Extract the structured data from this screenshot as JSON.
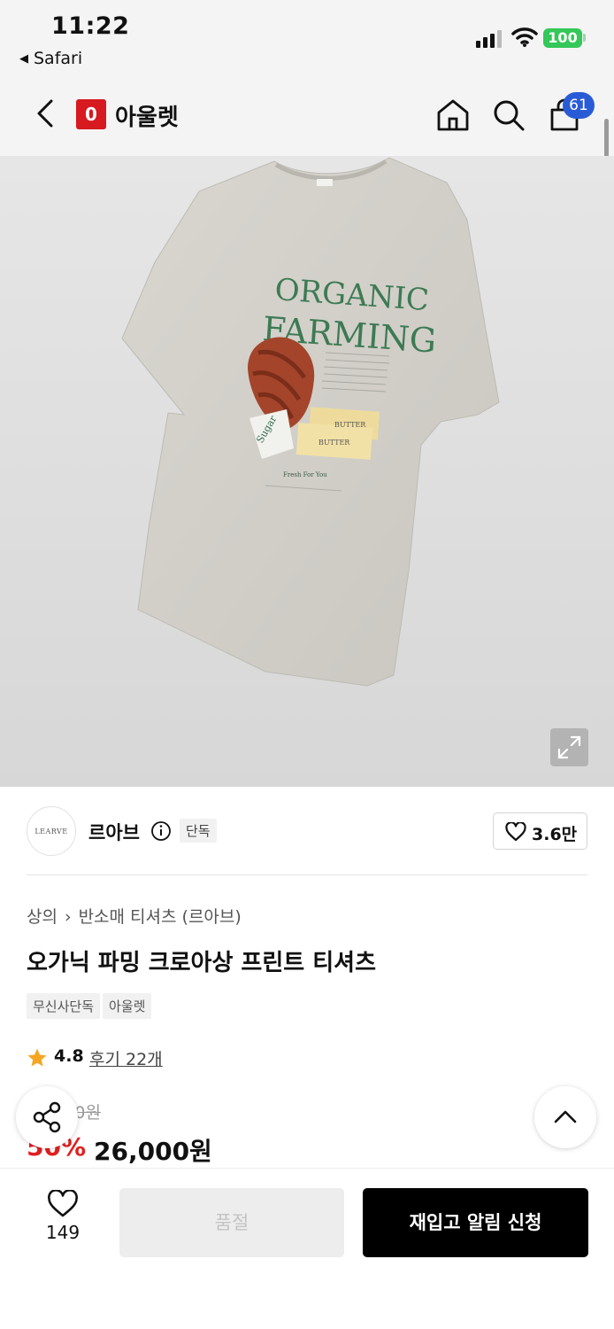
{
  "status_bar": {
    "time": "11:22",
    "back_app": "Safari",
    "battery": "100"
  },
  "header": {
    "logo_letter": "0",
    "title": "아울렛",
    "cart_count": "61"
  },
  "brand": {
    "logo_text": "LEARVE",
    "name": "르아브",
    "tag": "단독",
    "like_count": "3.6만"
  },
  "breadcrumb": {
    "category": "상의",
    "subcategory": "반소매 티셔츠 (르아브)"
  },
  "product": {
    "title": "오가닉 파밍 크로아상 프린트 티셔츠",
    "badges": [
      "무신사단독",
      "아울렛"
    ],
    "rating": "4.8",
    "reviews": "후기 22개",
    "original_price": "52,000원",
    "discount": "50%",
    "price": "26,000원",
    "print_line1": "ORGANIC",
    "print_line2": "FARMING",
    "print_sugar": "Sugar",
    "print_butter": "BUTTER",
    "print_fresh": "Fresh For You"
  },
  "actions": {
    "wish_count": "149",
    "soldout_label": "품절",
    "restock_label": "재입고 알림 신청"
  },
  "colors": {
    "brand_red": "#d71920",
    "discount_red": "#e02020",
    "badge_blue": "#2a5bd7",
    "battery_green": "#34c759"
  }
}
